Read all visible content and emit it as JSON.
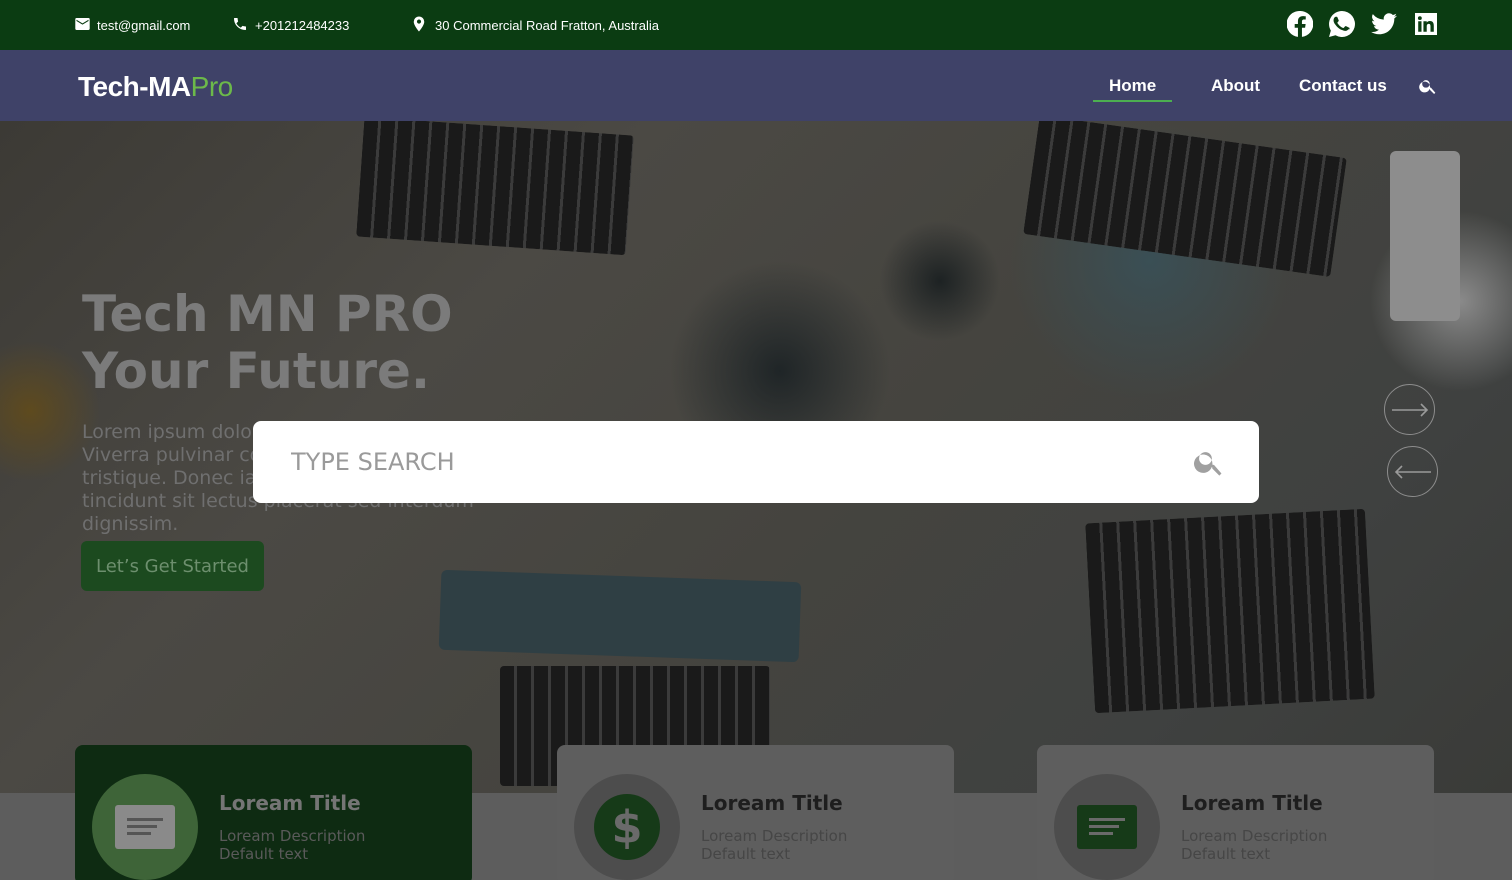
{
  "topbar": {
    "email": "test@gmail.com",
    "phone": "+201212484233",
    "address": "30 Commercial Road Fratton, Australia",
    "socials": [
      "facebook-icon",
      "whatsapp-icon",
      "twitter-icon",
      "linkedin-icon"
    ]
  },
  "nav": {
    "logo_main": "Tech-MA",
    "logo_accent": "Pro",
    "links": [
      {
        "label": "Home",
        "active": true
      },
      {
        "label": "About",
        "active": false
      },
      {
        "label": "Contact us",
        "active": false
      }
    ]
  },
  "hero": {
    "title_line1": "Tech MN PRO",
    "title_line2": "Your Future.",
    "description": "Lorem ipsum dolor sit amet consectetur. Viverra pulvinar consequat lacus egestas tristique. Donec iaculis amet. Nisi vitae sed tincidunt sit lectus placerat sed interdum dignissim.",
    "cta": "Let’s Get Started"
  },
  "search": {
    "placeholder": "TYPE SEARCH"
  },
  "cards": [
    {
      "title": "Loream Title",
      "description": "Loream Description",
      "default_text": "Default text",
      "icon": "document-lines-icon"
    },
    {
      "title": "Loream Title",
      "description": "Loream Description",
      "default_text": "Default text",
      "icon": "dollar-icon"
    },
    {
      "title": "Loream Title",
      "description": "Loream Description",
      "default_text": "Default text",
      "icon": "document-lines-icon"
    }
  ],
  "colors": {
    "topbar": "#0b3c12",
    "navbar": "#3f4268",
    "accent": "#4caf50"
  }
}
